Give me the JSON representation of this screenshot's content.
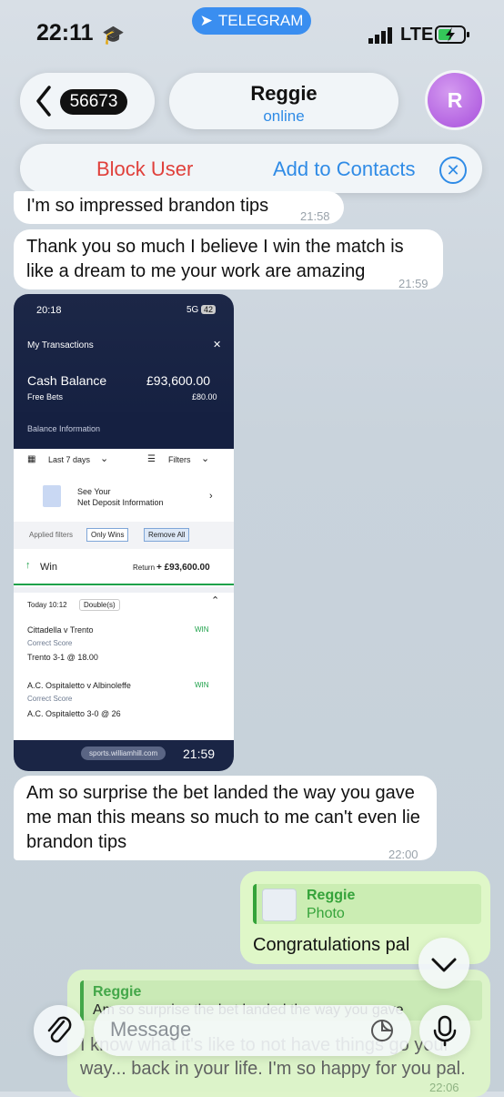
{
  "status_bar": {
    "time": "22:11",
    "network": "LTE",
    "pill": "TELEGRAM"
  },
  "header": {
    "back_count": "56673",
    "name": "Reggie",
    "status": "online",
    "avatar_letter": "R"
  },
  "actions": {
    "block": "Block User",
    "add": "Add to Contacts"
  },
  "messages": {
    "m1": {
      "text": "I'm  so impressed brandon tips",
      "time": "21:58"
    },
    "m2": {
      "text": "Thank you so much I believe I win the match is like a dream to me your work are amazing",
      "time": "21:59"
    },
    "photo": {
      "status_time": "20:18",
      "status_net": "5G",
      "battery": "42",
      "title": "My Transactions",
      "cash_label": "Cash Balance",
      "cash_value": "£93,600.00",
      "free_bets_label": "Free Bets",
      "free_bets_value": "£80.00",
      "balance_info": "Balance Information",
      "period": "Last 7 days",
      "filters": "Filters",
      "see_your": "See Your",
      "net_deposit": "Net Deposit Information",
      "applied": "Applied filters",
      "only_wins": "Only Wins",
      "remove_all": "Remove All",
      "win": "Win",
      "return_label": "Return",
      "return_value": "+ £93,600.00",
      "bet_time": "Today 10:12",
      "bet_type": "Double(s)",
      "leg1_match": "Cittadella v Trento",
      "leg1_market": "Correct Score",
      "leg1_pick": "Trento 3-1  @ 18.00",
      "leg2_match": "A.C. Ospitaletto v Albinoleffe",
      "leg2_market": "Correct Score",
      "leg2_pick": "A.C. Ospitaletto 3-0  @ 26",
      "win_tag": "WIN",
      "url": "sports.williamhill.com",
      "time": "21:59"
    },
    "m3": {
      "text": "Am so surprise the bet landed the way you gave me man this means so much to me can't even lie brandon tips",
      "time": "22:00"
    },
    "out1": {
      "reply_name": "Reggie",
      "reply_text": "Photo",
      "text": "Congratulations pal"
    },
    "out2": {
      "reply_name": "Reggie",
      "reply_text": "Am so surprise the bet landed the way you gave",
      "text": "I know what it's like to not have things go your way... back in your life. I'm so happy for you pal.",
      "time": "22:06"
    }
  },
  "input": {
    "placeholder": "Message"
  },
  "colors": {
    "accent": "#2f8be6",
    "danger": "#e0403b",
    "outgoing": "#dff7c8",
    "reply_green": "#35a33a"
  }
}
